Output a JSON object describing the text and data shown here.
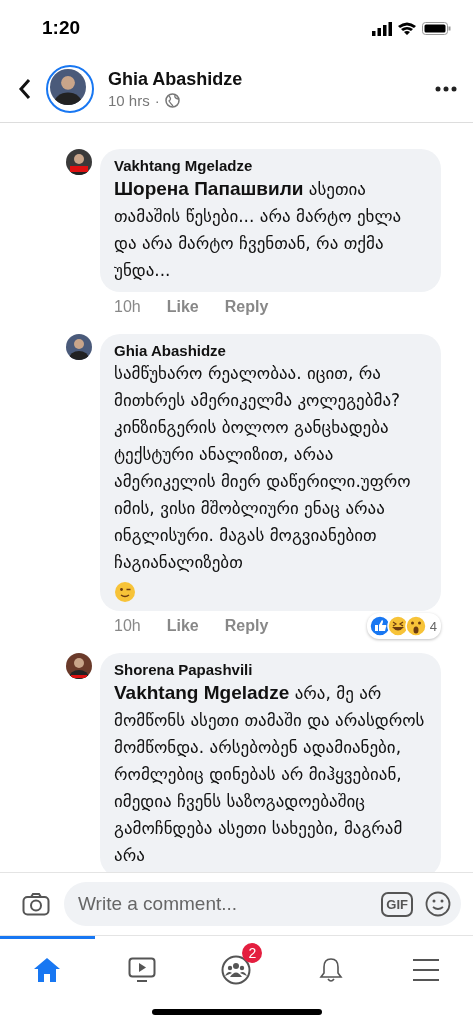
{
  "status_bar": {
    "time": "1:20"
  },
  "header": {
    "name": "Ghia Abashidze",
    "time": "10 hrs",
    "separator": "·"
  },
  "comments": [
    {
      "author": "Vakhtang Mgeladze",
      "text": "**Шорена Папашвили** ასეთია თამაშის წესები... არა მარტო ეხლა და არა მარტო ჩვენთან, რა თქმა უნდა...",
      "wink": false,
      "time": "10h",
      "like": "Like",
      "reply": "Reply"
    },
    {
      "author": "Ghia Abashidze",
      "text": "სამწუხარო რეალობაა. იცით, რა მითხრეს ამერიკელმა კოლეგებმა? კინზინგერის ბოლოო განცხადება ტექსტური ანალიზით, არაა ამერიკელის მიერ დაწერილი.უფრო იმის, ვისი მშობლიური ენაც არაა ინგლისური. მაგას მოგვიანებით ჩაგიანალიზებთ",
      "wink": true,
      "time": "10h",
      "like": "Like",
      "reply": "Reply",
      "reactions": {
        "count": "4"
      }
    },
    {
      "author": "Shorena Papashvili",
      "text": "**Vakhtang Mgeladze** არა, მე არ მომწონს ასეთი თამაში და არასდროს მომწონდა. არსებობენ ადამიანები, რომლებიც დინებას არ მიჰყვებიან, იმედია ჩვენს საზოგადოებაშიც გამოჩნდება ასეთი სახეები, მაგრამ არა",
      "wink": false
    }
  ],
  "composer": {
    "placeholder": "Write a comment...",
    "gif": "GIF"
  },
  "tabs": [
    {
      "kind": "home",
      "selected": true
    },
    {
      "kind": "watch",
      "selected": false
    },
    {
      "kind": "groups",
      "selected": false,
      "badge": "2"
    },
    {
      "kind": "notifications",
      "selected": false
    },
    {
      "kind": "menu",
      "selected": false
    }
  ]
}
